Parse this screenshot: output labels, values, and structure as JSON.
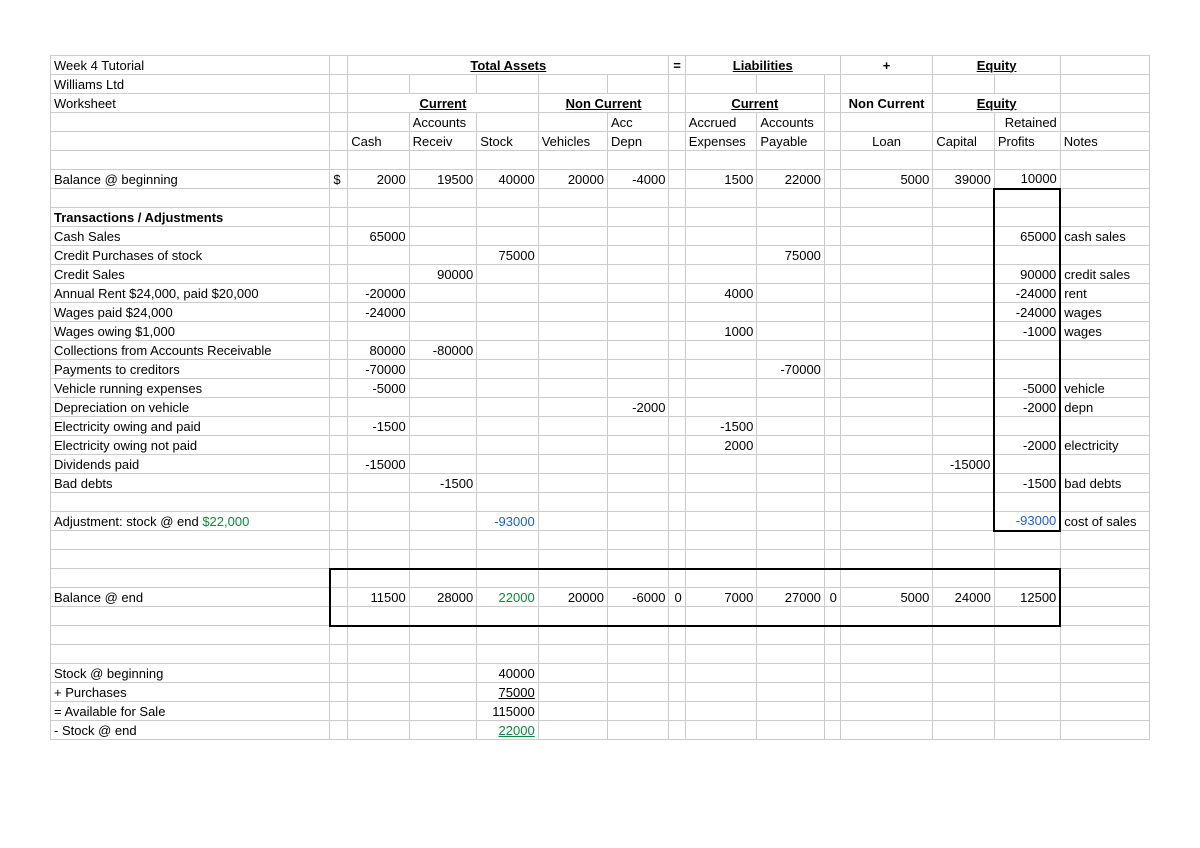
{
  "chart_data": {
    "type": "table",
    "title": "Week 4 Tutorial — Williams Ltd Worksheet",
    "equation_header": [
      "Total Assets",
      "=",
      "Liabilities",
      "+",
      "Equity"
    ],
    "section_headers": {
      "assets": [
        "Current",
        "Non Current"
      ],
      "liab": [
        "Current",
        "Non Current"
      ],
      "equity": [
        "Equity"
      ]
    },
    "columns": [
      "Cash",
      "Accounts Receiv",
      "Stock",
      "Vehicles",
      "Acc Depn",
      "Accrued Expenses",
      "Accounts Payable",
      "Loan",
      "Capital",
      "Retained Profits",
      "Notes"
    ],
    "rows": [
      {
        "label": "Balance @ beginning",
        "currency": "$",
        "cash": 2000,
        "ar": 19500,
        "stock": 40000,
        "veh": 20000,
        "depn": -4000,
        "acc_exp": 1500,
        "ap": 22000,
        "loan": 5000,
        "capital": 39000,
        "ret": 10000
      },
      {
        "label": "Cash Sales",
        "cash": 65000,
        "ret": 65000,
        "notes": "cash sales"
      },
      {
        "label": "Credit Purchases of stock",
        "stock": 75000,
        "ap": 75000
      },
      {
        "label": "Credit Sales",
        "ar": 90000,
        "ret": 90000,
        "notes": "credit sales"
      },
      {
        "label": "Annual Rent $24,000, paid $20,000",
        "cash": -20000,
        "acc_exp": 4000,
        "ret": -24000,
        "notes": "rent"
      },
      {
        "label": "Wages paid $24,000",
        "cash": -24000,
        "ret": -24000,
        "notes": "wages"
      },
      {
        "label": "Wages owing $1,000",
        "acc_exp": 1000,
        "ret": -1000,
        "notes": "wages"
      },
      {
        "label": "Collections from Accounts Receivable",
        "cash": 80000,
        "ar": -80000
      },
      {
        "label": "Payments to creditors",
        "cash": -70000,
        "ap": -70000
      },
      {
        "label": "Vehicle running expenses",
        "cash": -5000,
        "ret": -5000,
        "notes": "vehicle"
      },
      {
        "label": "Depreciation on vehicle",
        "depn": -2000,
        "ret": -2000,
        "notes": "depn"
      },
      {
        "label": "Electricity owing and paid",
        "cash": -1500,
        "acc_exp": -1500
      },
      {
        "label": "Electricity owing not paid",
        "acc_exp": 2000,
        "ret": -2000,
        "notes": "electricity"
      },
      {
        "label": "Dividends paid",
        "cash": -15000,
        "capital": -15000
      },
      {
        "label": "Bad debts",
        "ar": -1500,
        "ret": -1500,
        "notes": "bad debts"
      },
      {
        "label": "Adjustment: stock @ end $22,000",
        "stock": -93000,
        "ret": -93000,
        "notes": "cost of sales"
      },
      {
        "label": "Balance @ end",
        "cash": 11500,
        "ar": 28000,
        "stock": 22000,
        "veh": 20000,
        "depn": -6000,
        "z1": 0,
        "acc_exp": 7000,
        "ap": 27000,
        "z2": 0,
        "loan": 5000,
        "capital": 24000,
        "ret": 12500
      }
    ],
    "stock_reconciliation": [
      {
        "label": "Stock @ beginning",
        "stock": 40000
      },
      {
        "label": "+ Purchases",
        "stock": 75000,
        "underline": true
      },
      {
        "label": "= Available for Sale",
        "stock": 115000
      },
      {
        "label": "- Stock @ end",
        "stock": 22000,
        "green": true
      }
    ]
  },
  "h": {
    "title": "Week 4 Tutorial",
    "company": "Williams Ltd",
    "worksheet": "Worksheet",
    "ta": "Total Assets",
    "eq": "=",
    "liab": "Liabilities",
    "plus": "+",
    "equity": "Equity",
    "current": "Current",
    "noncurrent": "Non Current",
    "equity2": "Equity",
    "cash": "Cash",
    "accounts": "Accounts",
    "receiv": "Receiv",
    "stock": "Stock",
    "vehicles": "Vehicles",
    "acc": "Acc",
    "depn": "Depn",
    "accrued": "Accrued",
    "expenses": "Expenses",
    "payable": "Payable",
    "loan": "Loan",
    "capital": "Capital",
    "retained": "Retained",
    "profits": "Profits",
    "notes": "Notes",
    "currency": "$"
  },
  "r": {
    "bal_begin": "Balance @ beginning",
    "trans_adj": "Transactions / Adjustments",
    "cash_sales": "Cash Sales",
    "credit_purchases": "Credit Purchases of stock",
    "credit_sales": "Credit Sales",
    "rent": "Annual Rent $24,000, paid $20,000",
    "wages_paid": "Wages paid $24,000",
    "wages_owing": "Wages owing $1,000",
    "collections": "Collections from Accounts Receivable",
    "payments": "Payments to creditors",
    "vehicle_exp": "Vehicle running expenses",
    "depn_veh": "Depreciation on vehicle",
    "elec_paid": "Electricity owing and paid",
    "elec_notpaid": "Electricity owing not paid",
    "dividends": "Dividends paid",
    "bad_debts": "Bad debts",
    "adj_label": "Adjustment: stock @ end ",
    "adj_green": "$22,000",
    "bal_end": "Balance @ end",
    "stock_begin": "Stock @ beginning",
    "purchases_plus": "+ Purchases",
    "avail_sale": "= Available for Sale",
    "stock_end": "- Stock @ end"
  },
  "v": {
    "b": {
      "cash": "2000",
      "ar": "19500",
      "stock": "40000",
      "veh": "20000",
      "depn": "-4000",
      "exp": "1500",
      "ap": "22000",
      "loan": "5000",
      "cap": "39000",
      "ret": "10000"
    },
    "cs": {
      "cash": "65000",
      "ret": "65000",
      "n": "cash sales"
    },
    "cp": {
      "stock": "75000",
      "ap": "75000"
    },
    "crs": {
      "ar": "90000",
      "ret": "90000",
      "n": "credit sales"
    },
    "rent": {
      "cash": "-20000",
      "exp": "4000",
      "ret": "-24000",
      "n": "rent"
    },
    "wp": {
      "cash": "-24000",
      "ret": "-24000",
      "n": "wages"
    },
    "wo": {
      "exp": "1000",
      "ret": "-1000",
      "n": "wages"
    },
    "col": {
      "cash": "80000",
      "ar": "-80000"
    },
    "pay": {
      "cash": "-70000",
      "ap": "-70000"
    },
    "ve": {
      "cash": "-5000",
      "ret": "-5000",
      "n": "vehicle"
    },
    "dv": {
      "depn": "-2000",
      "ret": "-2000",
      "n": "depn"
    },
    "ep": {
      "cash": "-1500",
      "exp": "-1500"
    },
    "enp": {
      "exp": "2000",
      "ret": "-2000",
      "n": "electricity"
    },
    "div": {
      "cash": "-15000",
      "cap": "-15000"
    },
    "bd": {
      "ar": "-1500",
      "ret": "-1500",
      "n": "bad debts"
    },
    "adj": {
      "stock": "-93000",
      "ret": "-93000",
      "n": "cost of sales"
    },
    "be": {
      "cash": "11500",
      "ar": "28000",
      "stock": "22000",
      "veh": "20000",
      "depn": "-6000",
      "z1": "0",
      "exp": "7000",
      "ap": "27000",
      "z2": "0",
      "loan": "5000",
      "cap": "24000",
      "ret": "12500"
    },
    "sb": "40000",
    "pp": "75000",
    "af": "115000",
    "se": "22000"
  }
}
